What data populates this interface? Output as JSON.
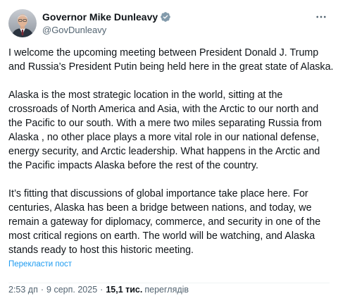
{
  "author": {
    "display_name": "Governor Mike Dunleavy",
    "handle": "@GovDunleavy",
    "verified_badge_color": "#829aab",
    "avatar_icon": "person-photo"
  },
  "tweet": {
    "paragraphs": [
      "I welcome the upcoming meeting between President Donald J. Trump and Russia’s President Putin being held here in the great state of Alaska.",
      "Alaska is the most strategic location in the world, sitting at the crossroads of North America and Asia, with the Arctic to our north and the Pacific to our south. With a mere two miles separating Russia from Alaska , no other place plays a more vital role in our national defense, energy security, and Arctic leadership. What happens in the Arctic and the Pacific impacts Alaska before the rest of the country.",
      "It’s fitting that discussions of global importance take place here. For centuries, Alaska has been a bridge between nations, and today, we remain a gateway for diplomacy, commerce, and security in one of the most critical regions on earth. The world will be watching, and Alaska stands ready to host this historic meeting."
    ],
    "translate_label": "Перекласти пост"
  },
  "meta": {
    "time": "2:53 дп",
    "separator": "·",
    "date": "9 серп. 2025",
    "views_count": "15,1 тис.",
    "views_label": "переглядів"
  },
  "colors": {
    "text": "#0f1419",
    "secondary": "#536471",
    "link": "#1d9bf0"
  }
}
